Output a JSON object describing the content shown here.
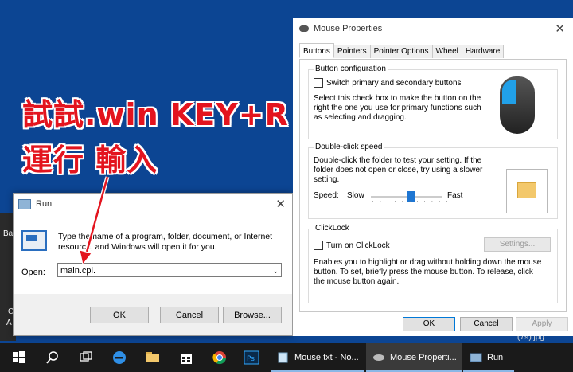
{
  "annotation": {
    "line1": "試試.win KEY+R",
    "line2": "運行 輸入"
  },
  "desktop": {
    "frag_ba": "Ba",
    "frag_c": "C",
    "frag_a": "A",
    "frag_jpg": "(79).jpg"
  },
  "run_dialog": {
    "title": "Run",
    "close_glyph": "✕",
    "description": "Type the name of a program, folder, document, or Internet resource, and Windows will open it for you.",
    "open_label": "Open:",
    "open_value": "main.cpl.",
    "ok": "OK",
    "cancel": "Cancel",
    "browse": "Browse..."
  },
  "mouse_properties": {
    "title": "Mouse Properties",
    "close_glyph": "✕",
    "tabs": [
      "Buttons",
      "Pointers",
      "Pointer Options",
      "Wheel",
      "Hardware"
    ],
    "button_config": {
      "legend": "Button configuration",
      "checkbox_label": "Switch primary and secondary buttons",
      "text": "Select this check box to make the button on the right the one you use for primary functions such as selecting and dragging."
    },
    "double_click": {
      "legend": "Double-click speed",
      "text": "Double-click the folder to test your setting. If the folder does not open or close, try using a slower setting.",
      "speed_label": "Speed:",
      "slow": "Slow",
      "fast": "Fast",
      "slider_fraction": 0.55
    },
    "clicklock": {
      "legend": "ClickLock",
      "checkbox_label": "Turn on ClickLock",
      "settings": "Settings...",
      "text": "Enables you to highlight or drag without holding down the mouse button. To set, briefly press the mouse button. To release, click the mouse button again."
    },
    "ok": "OK",
    "cancel": "Cancel",
    "apply": "Apply"
  },
  "taskbar": {
    "apps": [
      {
        "label": "Mouse.txt - No...",
        "active": false
      },
      {
        "label": "Mouse Properti...",
        "active": true
      },
      {
        "label": "Run",
        "active": false
      }
    ]
  },
  "colors": {
    "accent": "#0078d7",
    "annotation": "#e3141e",
    "desktop": "#0c4593",
    "taskbar": "#1a1a1a"
  }
}
